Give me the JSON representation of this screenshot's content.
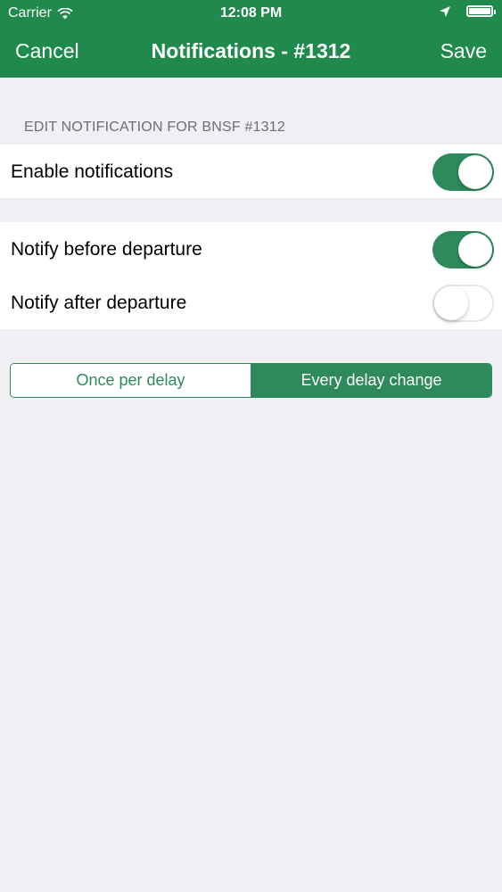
{
  "status_bar": {
    "carrier": "Carrier",
    "time": "12:08 PM",
    "icons": [
      "wifi-icon",
      "location-arrow-icon",
      "battery-icon"
    ]
  },
  "nav": {
    "cancel": "Cancel",
    "title": "Notifications - #1312",
    "save": "Save"
  },
  "section": {
    "header": "EDIT NOTIFICATION FOR BNSF #1312"
  },
  "settings": {
    "enable": {
      "label": "Enable notifications",
      "on": true
    },
    "before": {
      "label": "Notify before departure",
      "on": true
    },
    "after": {
      "label": "Notify after departure",
      "on": false
    }
  },
  "frequency": {
    "options": [
      "Once per delay",
      "Every delay change"
    ],
    "selected": "Every delay change"
  },
  "colors": {
    "nav_background": "#1f8a4c",
    "accent": "#2e8a5a",
    "page_background": "#efeff4"
  }
}
